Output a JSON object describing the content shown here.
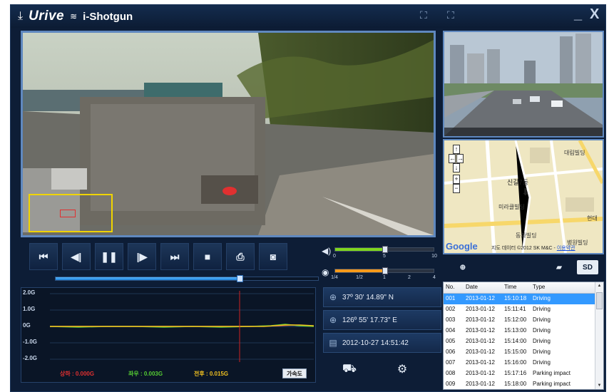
{
  "app": {
    "brand": "Urive",
    "product": "i-Shotgun"
  },
  "colors": {
    "accent": "#5f88bf",
    "selected_row": "#3399ff",
    "volume": "#7fd61e",
    "speed": "#ff9a1a",
    "cursor_line": "#cc2222"
  },
  "sliders": {
    "volume": {
      "ticks": [
        "0",
        "5",
        "10"
      ],
      "value": 5
    },
    "speed": {
      "ticks": [
        "1/4",
        "1/2",
        "1",
        "2",
        "4"
      ],
      "value": 1
    }
  },
  "playback": {
    "progress": 0.7
  },
  "map": {
    "labels": [
      "신길7동",
      "미라클빌딩",
      "대림빌딩",
      "동화빌딩",
      "병원빌딩",
      "현대"
    ],
    "attribution_prefix": "지도 데이터 ©2012 SK M&C - ",
    "terms": "이용약관",
    "brand": "Google"
  },
  "graph": {
    "y_labels": [
      "2.0G",
      "1.0G",
      "0G",
      "-1.0G",
      "-2.0G"
    ],
    "legend": {
      "vertical": "상하 : 0.000G",
      "lateral": "좌우 : 0.003G",
      "longitudinal": "전후 : 0.015G"
    },
    "accel_button": "가속도"
  },
  "info": {
    "latitude": "37º 30' 14.89\" N",
    "longitude": "126º 55' 17.73\" E",
    "datetime": "2012-10-27 14:51:42"
  },
  "tabs": {
    "sd_label": "SD"
  },
  "event_list": {
    "headers": {
      "no": "No.",
      "date": "Date",
      "time": "Time",
      "type": "Type"
    },
    "rows": [
      {
        "no": "001",
        "date": "2013-01-12",
        "time": "15:10:18",
        "type": "Driving",
        "selected": true
      },
      {
        "no": "002",
        "date": "2013-01-12",
        "time": "15:11:41",
        "type": "Driving"
      },
      {
        "no": "003",
        "date": "2013-01-12",
        "time": "15:12:00",
        "type": "Driving"
      },
      {
        "no": "004",
        "date": "2013-01-12",
        "time": "15:13:00",
        "type": "Driving"
      },
      {
        "no": "005",
        "date": "2013-01-12",
        "time": "15:14:00",
        "type": "Driving"
      },
      {
        "no": "006",
        "date": "2013-01-12",
        "time": "15:15:00",
        "type": "Driving"
      },
      {
        "no": "007",
        "date": "2013-01-12",
        "time": "15:16:00",
        "type": "Driving"
      },
      {
        "no": "008",
        "date": "2013-01-12",
        "time": "15:17:16",
        "type": "Parking impact"
      },
      {
        "no": "009",
        "date": "2013-01-12",
        "time": "15:18:00",
        "type": "Parking impact"
      }
    ]
  }
}
